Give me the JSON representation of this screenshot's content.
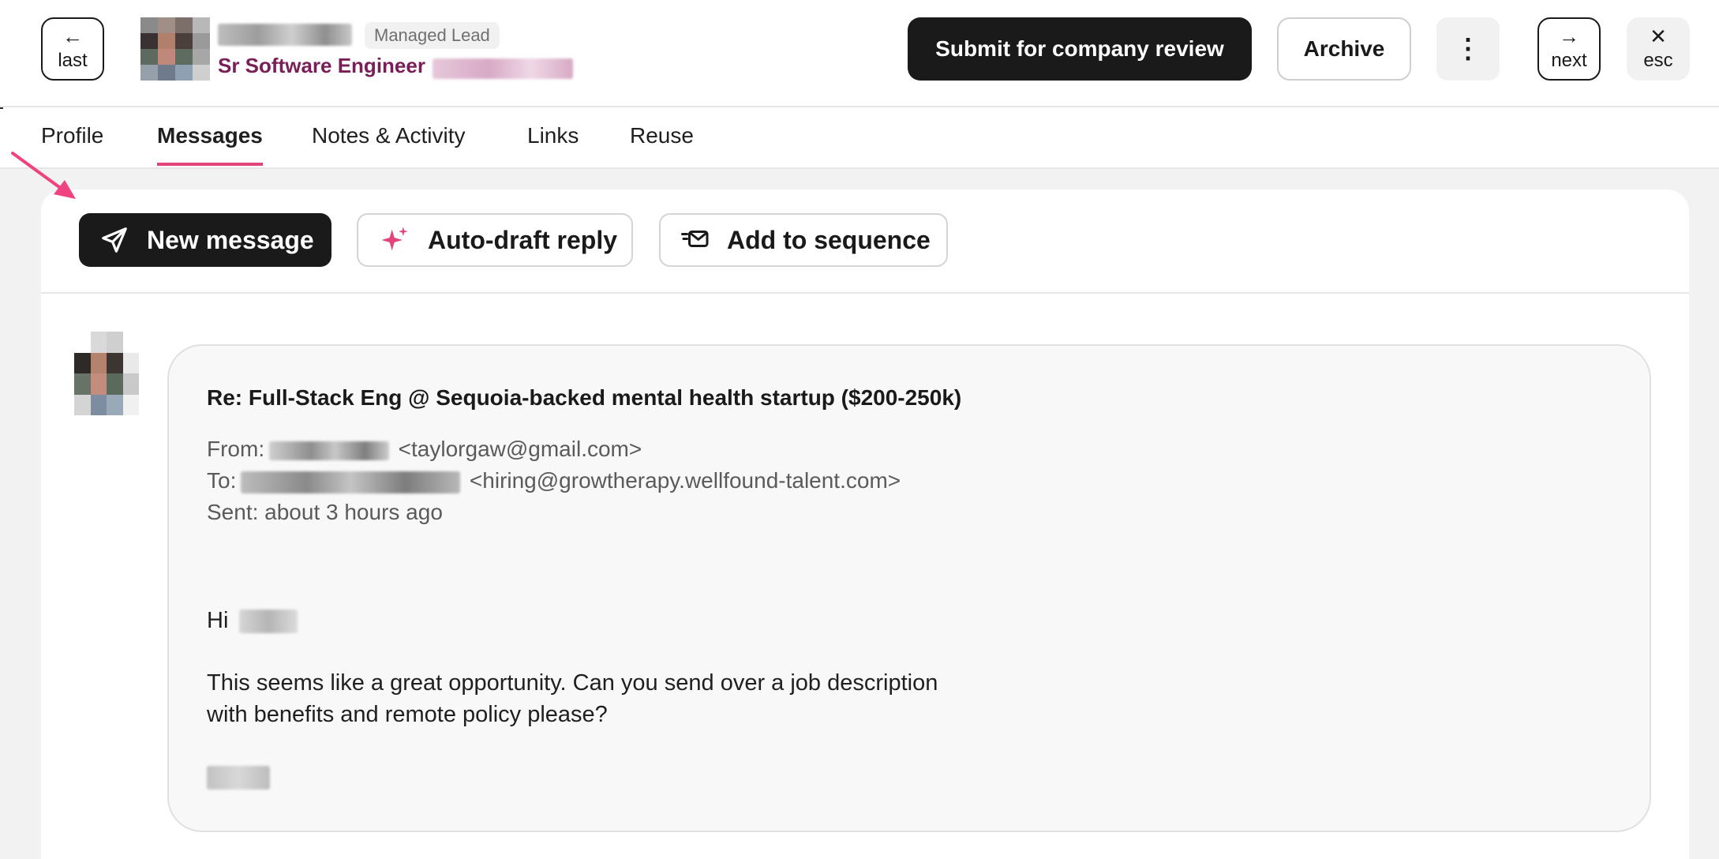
{
  "header": {
    "last_label": "last",
    "next_label": "next",
    "esc_label": "esc",
    "badge": "Managed Lead",
    "job_title": "Sr Software Engineer",
    "submit_label": "Submit for company review",
    "archive_label": "Archive"
  },
  "tabs": [
    {
      "label": "Profile",
      "active": false
    },
    {
      "label": "Messages",
      "active": true
    },
    {
      "label": "Notes & Activity",
      "active": false
    },
    {
      "label": "Links",
      "active": false
    },
    {
      "label": "Reuse",
      "active": false
    }
  ],
  "toolbar": {
    "new_message": "New message",
    "auto_draft": "Auto-draft reply",
    "add_sequence": "Add to sequence"
  },
  "message": {
    "subject": "Re: Full-Stack Eng @ Sequoia-backed mental health startup ($200-250k)",
    "from_prefix": "From:",
    "from_email": "<taylorgaw@gmail.com>",
    "to_prefix": "To:",
    "to_email": "<hiring@growtherapy.wellfound-talent.com>",
    "sent": "Sent: about 3 hours ago",
    "greeting": "Hi",
    "body_line1": "This seems like a great opportunity. Can you send over a job description",
    "body_line2": "with benefits and remote policy please?"
  },
  "colors": {
    "accent_pink": "#e1457a",
    "job_title": "#7a1e57",
    "primary_button": "#1a1a1a"
  }
}
